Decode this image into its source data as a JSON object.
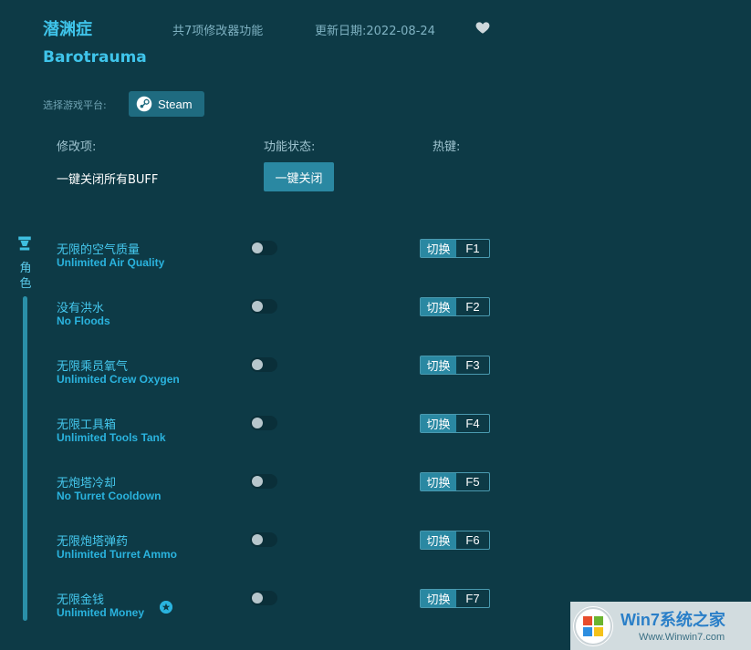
{
  "header": {
    "title_cn": "潜渊症",
    "title_en": "Barotrauma",
    "feature_count": "共7项修改器功能",
    "update_date": "更新日期:2022-08-24"
  },
  "platform": {
    "label": "选择游戏平台:",
    "steam_label": "Steam"
  },
  "columns": {
    "item": "修改项:",
    "status": "功能状态:",
    "hotkey": "热键:"
  },
  "buff": {
    "label": "一键关闭所有BUFF",
    "button": "一键关闭"
  },
  "sidebar": {
    "category": "角色"
  },
  "rows": [
    {
      "cn": "无限的空气质量",
      "en": "Unlimited Air Quality",
      "switch": "切换",
      "key": "F1"
    },
    {
      "cn": "没有洪水",
      "en": "No Floods",
      "switch": "切换",
      "key": "F2"
    },
    {
      "cn": "无限乘员氧气",
      "en": "Unlimited Crew Oxygen",
      "switch": "切换",
      "key": "F3"
    },
    {
      "cn": "无限工具箱",
      "en": "Unlimited Tools Tank",
      "switch": "切换",
      "key": "F4"
    },
    {
      "cn": "无炮塔冷却",
      "en": "No Turret Cooldown",
      "switch": "切换",
      "key": "F5"
    },
    {
      "cn": "无限炮塔弹药",
      "en": "Unlimited Turret Ammo",
      "switch": "切换",
      "key": "F6"
    },
    {
      "cn": "无限金钱",
      "en": "Unlimited Money",
      "switch": "切换",
      "key": "F7"
    }
  ],
  "watermark": {
    "brand": "Win7系统之家",
    "url": "Www.Winwin7.com"
  }
}
